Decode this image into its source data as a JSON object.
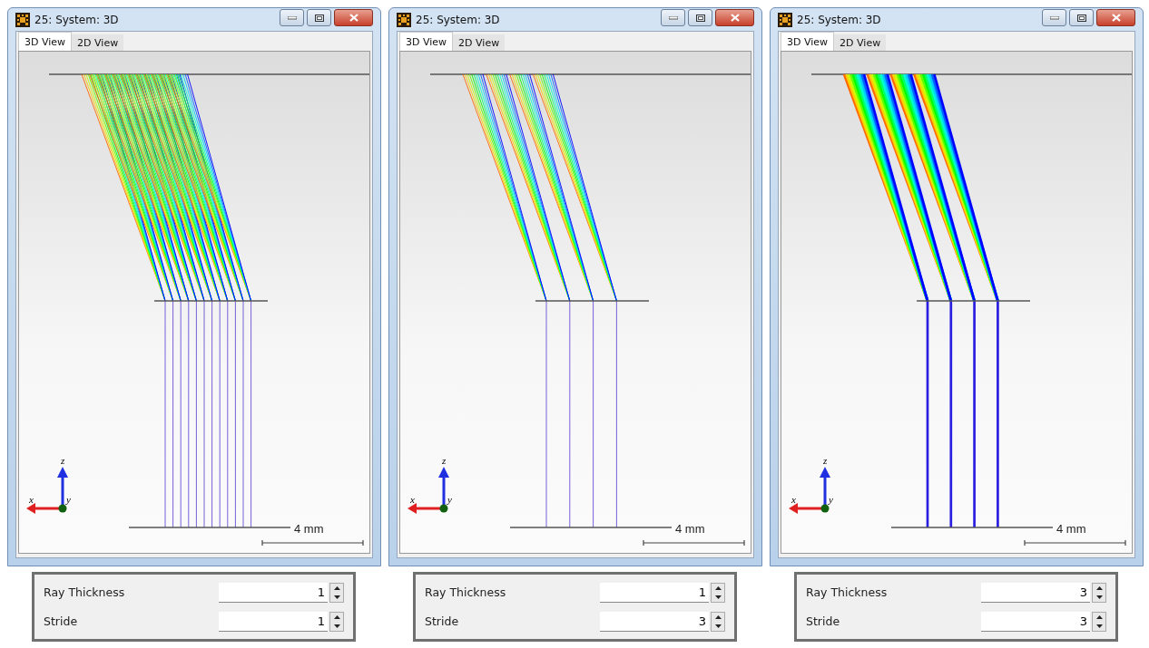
{
  "windows": [
    {
      "title": "25: System: 3D",
      "tabs": [
        {
          "label": "3D View",
          "selected": true
        },
        {
          "label": "2D View",
          "selected": false
        }
      ],
      "axes": {
        "x": "x",
        "y": "y",
        "z": "z"
      },
      "scale_label": "4 mm",
      "settings": [
        {
          "label": "Ray Thickness",
          "value": "1"
        },
        {
          "label": "Stride",
          "value": "1"
        }
      ]
    },
    {
      "title": "25: System: 3D",
      "tabs": [
        {
          "label": "3D View",
          "selected": true
        },
        {
          "label": "2D View",
          "selected": false
        }
      ],
      "axes": {
        "x": "x",
        "y": "y",
        "z": "z"
      },
      "scale_label": "4 mm",
      "settings": [
        {
          "label": "Ray Thickness",
          "value": "1"
        },
        {
          "label": "Stride",
          "value": "3"
        }
      ]
    },
    {
      "title": "25: System: 3D",
      "tabs": [
        {
          "label": "3D View",
          "selected": true
        },
        {
          "label": "2D View",
          "selected": false
        }
      ],
      "axes": {
        "x": "x",
        "y": "y",
        "z": "z"
      },
      "scale_label": "4 mm",
      "settings": [
        {
          "label": "Ray Thickness",
          "value": "3"
        },
        {
          "label": "Stride",
          "value": "3"
        }
      ]
    }
  ]
}
